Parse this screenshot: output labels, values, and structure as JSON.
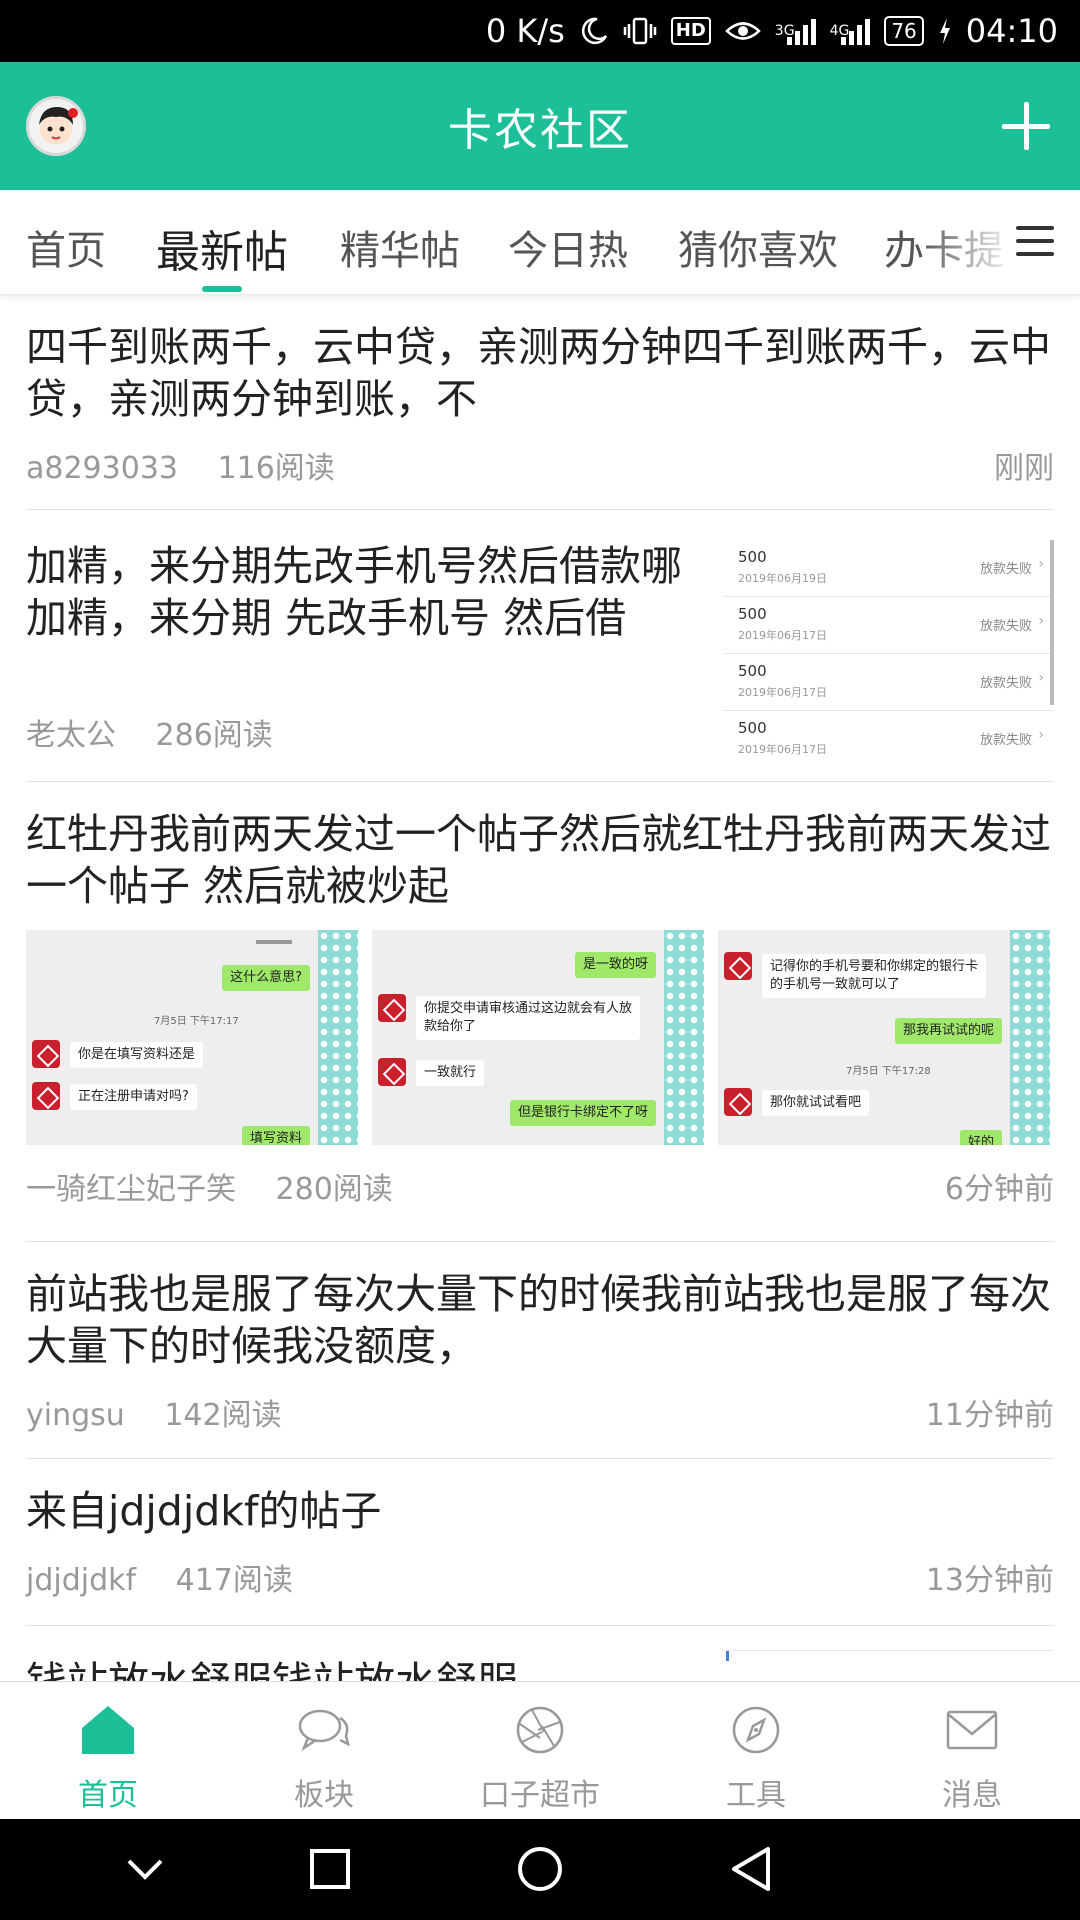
{
  "status_bar": {
    "speed": "0 K/s",
    "hd": "HD",
    "net1": "3G",
    "net2": "4G",
    "battery": "76",
    "time": "04:10"
  },
  "header": {
    "title": "卡农社区",
    "avatar_icon": "avatar-icon",
    "add_icon": "plus-icon"
  },
  "tabs": {
    "items": [
      "首页",
      "最新帖",
      "精华帖",
      "今日热",
      "猜你喜欢",
      "办卡提"
    ],
    "active_index": 1,
    "menu_icon": "hamburger-menu-icon"
  },
  "posts": [
    {
      "title": "四千到账两千，云中贷，亲测两分钟四千到账两千，云中贷，亲测两分钟到账，不",
      "author": "a8293033",
      "reads": "116阅读",
      "time": "刚刚"
    },
    {
      "title": "加精，来分期先改手机号然后借款哪加精，来分期 先改手机号 然后借",
      "author": "老太公",
      "reads": "286阅读",
      "time": "",
      "thumbnail_rows": [
        {
          "amount": "500",
          "date": "2019年06月19日",
          "status": "放款失败"
        },
        {
          "amount": "500",
          "date": "2019年06月17日",
          "status": "放款失败"
        },
        {
          "amount": "500",
          "date": "2019年06月17日",
          "status": "放款失败"
        },
        {
          "amount": "500",
          "date": "2019年06月17日",
          "status": "放款失败"
        }
      ]
    },
    {
      "title": "红牡丹我前两天发过一个帖子然后就红牡丹我前两天发过一个帖子 然后就被炒起",
      "author": "一骑红尘妃子笑",
      "reads": "280阅读",
      "time": "6分钟前",
      "images": [
        {
          "time": "7月5日 下午17:17",
          "bubbles": [
            "这什么意思?",
            "你是在填写资料还是",
            "正在注册申请对吗?",
            "填写资料"
          ]
        },
        {
          "bubbles": [
            "是一致的呀",
            "你提交申请审核通过这边就会有人放",
            "款给你了",
            "一致就行",
            "但是银行卡绑定不了呀"
          ]
        },
        {
          "time": "7月5日 下午17:28",
          "bubbles": [
            "记得你的手机号要和你绑定的银行卡",
            "的手机号一致就可以了",
            "那我再试试的呢",
            "那你就试试看吧",
            "好的"
          ]
        }
      ]
    },
    {
      "title": "前站我也是服了每次大量下的时候我前站我也是服了每次大量下的时候我没额度，",
      "author": "yingsu",
      "reads": "142阅读",
      "time": "11分钟前"
    },
    {
      "title": "来自jdjdjdkf的帖子",
      "author": "jdjdjdkf",
      "reads": "417阅读",
      "time": "13分钟前"
    },
    {
      "title": "钱站放水舒服钱站放水舒服",
      "author": "",
      "reads": "",
      "time": ""
    }
  ],
  "bottom_nav": {
    "items": [
      {
        "label": "首页",
        "icon": "home-icon"
      },
      {
        "label": "板块",
        "icon": "chat-bubbles-icon"
      },
      {
        "label": "口子超市",
        "icon": "aperture-icon"
      },
      {
        "label": "工具",
        "icon": "compass-icon"
      },
      {
        "label": "消息",
        "icon": "envelope-icon"
      }
    ],
    "active_index": 0
  },
  "colors": {
    "brand": "#1dbf98",
    "text": "#222222",
    "muted": "#999999"
  }
}
